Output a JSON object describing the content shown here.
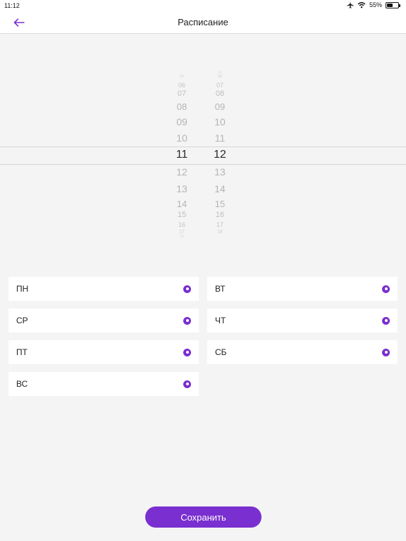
{
  "status": {
    "time": "11:12",
    "battery": "55%",
    "battery_level": 0.55,
    "icons": [
      "airplane-icon",
      "wifi-icon",
      "battery-icon"
    ]
  },
  "header": {
    "title": "Расписание",
    "back_icon": "arrow-left-icon"
  },
  "picker": {
    "hours": [
      "05",
      "06",
      "07",
      "08",
      "09",
      "10",
      "11",
      "12",
      "13",
      "14",
      "15",
      "16",
      "17",
      "18"
    ],
    "minutes": [
      "06",
      "06",
      "07",
      "08",
      "09",
      "10",
      "11",
      "12",
      "13",
      "14",
      "15",
      "16",
      "17",
      "18"
    ],
    "selected_hour": "11",
    "selected_minute": "12"
  },
  "days": [
    {
      "label": "ПН",
      "checked": true
    },
    {
      "label": "ВТ",
      "checked": true
    },
    {
      "label": "СР",
      "checked": true
    },
    {
      "label": "ЧТ",
      "checked": true
    },
    {
      "label": "ПТ",
      "checked": true
    },
    {
      "label": "СБ",
      "checked": true
    },
    {
      "label": "ВС",
      "checked": true
    }
  ],
  "save_label": "Сохранить",
  "colors": {
    "accent": "#7a2fd0",
    "background": "#f4f4f4"
  }
}
